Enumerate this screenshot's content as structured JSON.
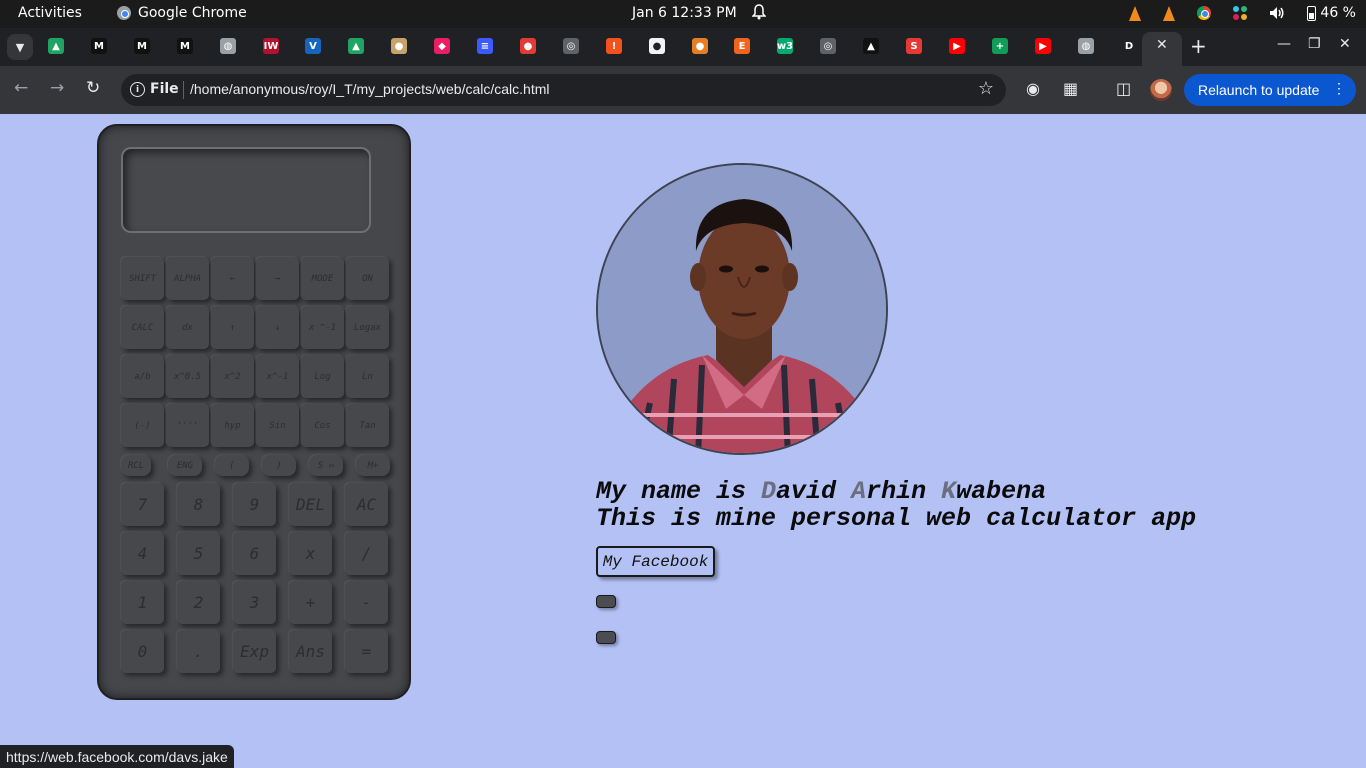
{
  "system_bar": {
    "activities": "Activities",
    "app_name": "Google Chrome",
    "datetime": "Jan 6  12:33 PM",
    "battery": "46 %"
  },
  "tabs": {
    "favicons": [
      {
        "name": "google-drive",
        "glyph": "▲",
        "color": "#1fa463"
      },
      {
        "name": "medium",
        "glyph": "M",
        "color": "#111111"
      },
      {
        "name": "medium",
        "glyph": "M",
        "color": "#111111"
      },
      {
        "name": "medium",
        "glyph": "M",
        "color": "#111111"
      },
      {
        "name": "globe",
        "glyph": "◍",
        "color": "#9aa0a6"
      },
      {
        "name": "iw",
        "glyph": "IW",
        "color": "#b3112e"
      },
      {
        "name": "v-logo",
        "glyph": "V",
        "color": "#1565c0"
      },
      {
        "name": "google-drive",
        "glyph": "▲",
        "color": "#1fa463"
      },
      {
        "name": "owl",
        "glyph": "●",
        "color": "#c8a26a"
      },
      {
        "name": "cube",
        "glyph": "◆",
        "color": "#e91e63"
      },
      {
        "name": "list",
        "glyph": "≡",
        "color": "#3d5afe"
      },
      {
        "name": "circle-logo",
        "glyph": "●",
        "color": "#e53935"
      },
      {
        "name": "settings-logo",
        "glyph": "◎",
        "color": "#5f6368"
      },
      {
        "name": "alert",
        "glyph": "!",
        "color": "#f4511e"
      },
      {
        "name": "github",
        "glyph": "●",
        "color": "#f1f3f4"
      },
      {
        "name": "orange-logo",
        "glyph": "●",
        "color": "#e67e22"
      },
      {
        "name": "etsy",
        "glyph": "E",
        "color": "#f1641e"
      },
      {
        "name": "w3",
        "glyph": "w3",
        "color": "#04aa6d"
      },
      {
        "name": "settings-logo",
        "glyph": "◎",
        "color": "#5f6368"
      },
      {
        "name": "triangle",
        "glyph": "▲",
        "color": "#111111"
      },
      {
        "name": "s-logo",
        "glyph": "S",
        "color": "#e53935"
      },
      {
        "name": "youtube",
        "glyph": "▶",
        "color": "#ff0000"
      },
      {
        "name": "sheets",
        "glyph": "+",
        "color": "#0f9d58"
      },
      {
        "name": "youtube",
        "glyph": "▶",
        "color": "#ff0000"
      },
      {
        "name": "globe",
        "glyph": "◍",
        "color": "#9aa0a6"
      },
      {
        "name": "d-logo",
        "glyph": "D",
        "color": "#202124"
      }
    ]
  },
  "toolbar": {
    "file_label": "File",
    "url": "/home/anonymous/roy/I_T/my_projects/web/calc/calc.html",
    "relaunch_label": "Relaunch to update"
  },
  "calculator": {
    "fn_rows": [
      [
        "SHIFT",
        "ALPHA",
        "←",
        "→",
        "MODE",
        "ON"
      ],
      [
        "CALC",
        "dx",
        "↑",
        "↓",
        "x ^-1",
        "Logax"
      ],
      [
        "a/b",
        "x^0.5",
        "x^2",
        "x^-1",
        "Log",
        "Ln"
      ],
      [
        "(-)",
        "''''",
        "hyp",
        "Sin",
        "Cos",
        "Tan"
      ]
    ],
    "small_row": [
      "RCL",
      "ENG",
      "(",
      ")",
      "S ⇔",
      "M+"
    ],
    "num_rows": [
      [
        "7",
        "8",
        "9",
        "DEL",
        "AC"
      ],
      [
        "4",
        "5",
        "6",
        "x",
        "/"
      ],
      [
        "1",
        "2",
        "3",
        "+",
        "-"
      ],
      [
        "0",
        ".",
        "Exp",
        "Ans",
        "="
      ]
    ]
  },
  "intro": {
    "line1_prefix": "My name is ",
    "first_initial": "D",
    "first_rest": "avid ",
    "middle_initial": "A",
    "middle_rest": "rhin ",
    "last_initial": "K",
    "last_rest": "wabena",
    "line2": "This is mine personal web calculator app"
  },
  "buttons": {
    "facebook_label": "My Facebook"
  },
  "status_url": "https://web.facebook.com/davs.jake",
  "colors": {
    "page_bg": "#b3c1f5",
    "calculator_body": "#45474b",
    "relaunch_button": "#0b57d0"
  }
}
